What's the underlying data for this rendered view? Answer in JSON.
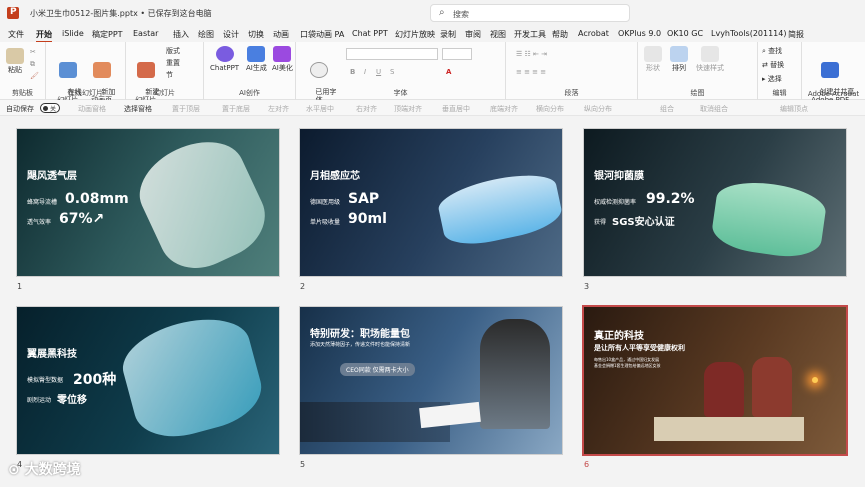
{
  "window": {
    "title": "小米卫生巾0512-图片集.pptx • 已保存到这台电脑",
    "search_placeholder": "搜索"
  },
  "menu": [
    "文件",
    "开始",
    "iSlide",
    "稿定PPT",
    "Eastar",
    "插入",
    "绘图",
    "设计",
    "切换",
    "动画",
    "口袋动画 PA",
    "Chat PPT",
    "幻灯片放映",
    "录制",
    "审阅",
    "视图",
    "开发工具",
    "帮助",
    "Acrobat",
    "OKPlus 9.0",
    "OK10 GC",
    "LvyhTools(201114)",
    "简报"
  ],
  "ribbon": {
    "clipboard": {
      "paste": "粘贴",
      "label": "剪贴板"
    },
    "online_slides": {
      "online": "在线\n幻灯片",
      "new_anim": "新加\n动画页",
      "label": "在线幻灯片"
    },
    "slides": {
      "new": "新建\n幻灯片",
      "layout": "版式",
      "reset": "重置",
      "section": "节",
      "label": "幻灯片"
    },
    "ai": {
      "chatppt": "ChatPPT",
      "ai_gen": "AI生成",
      "ai_beautify": "AI美化",
      "label": "AI创作"
    },
    "text": {
      "common": "已用字\n体",
      "label": "字体"
    },
    "paragraph": {
      "label": "段落"
    },
    "drawing": {
      "shape": "形状",
      "arrange": "排列",
      "quick_style": "快速样式",
      "label": "绘图"
    },
    "editing": {
      "find": "查找",
      "replace": "替换",
      "select": "选择",
      "label": "编辑"
    },
    "adobe": {
      "create": "创建并共享\nAdobe PDF",
      "label": "Adobe Acrobat"
    }
  },
  "toolbar2": {
    "autosave": "自动保存",
    "autosave_state": "关",
    "items": [
      "动画窗格",
      "选择窗格",
      "置于顶层",
      "置于底层",
      "左对齐",
      "水平居中",
      "右对齐",
      "顶端对齐",
      "垂直居中",
      "底端对齐",
      "横向分布",
      "纵向分布",
      "组合",
      "取消组合",
      "编辑顶点"
    ]
  },
  "slides": [
    {
      "num": "1",
      "title": "飓风透气层",
      "l1": "蜂窝导流槽",
      "v1": "0.08mm",
      "l2": "透气效率",
      "v2": "67%↗"
    },
    {
      "num": "2",
      "title": "月相感应芯",
      "l1": "德国医用级",
      "v1": "SAP",
      "l2": "单片吸收量",
      "v2": "90ml"
    },
    {
      "num": "3",
      "title": "银河抑菌膜",
      "l1": "权威检测抑菌率",
      "v1": "99.2%",
      "l2": "获得",
      "v2": "SGS安心认证"
    },
    {
      "num": "4",
      "title": "翼展黑科技",
      "l1": "模拟臀型数据",
      "v1": "200种",
      "l2": "剧烈运动",
      "v2": "零位移"
    },
    {
      "num": "5",
      "title": "特别研发：职场能量包",
      "sub": "添加天然薄荷因子，传递文件时也能保持清新",
      "tag": "CEO同款 仅需两卡大小"
    },
    {
      "num": "6",
      "title": "真正的科技",
      "sub": "是让所有人平等享受健康权利",
      "note": "每售出10盒产品，通过中国妇女发展基金会捐赠1套生理包给偏远地区女孩"
    }
  ],
  "watermark": "⊙ 大数跨境"
}
